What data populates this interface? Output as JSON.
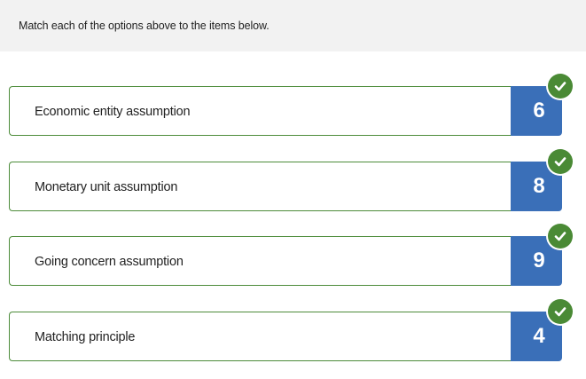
{
  "instruction": "Match each of the options above to the items below.",
  "colors": {
    "correct_border": "#4d8c3a",
    "answer_tile": "#3a6fb8",
    "check_badge": "#4a8a35"
  },
  "items": [
    {
      "label": "Economic entity assumption",
      "answer": "6",
      "status_icon": "check-icon"
    },
    {
      "label": "Monetary unit assumption",
      "answer": "8",
      "status_icon": "check-icon"
    },
    {
      "label": "Going concern assumption",
      "answer": "9",
      "status_icon": "check-icon"
    },
    {
      "label": "Matching principle",
      "answer": "4",
      "status_icon": "check-icon"
    }
  ]
}
